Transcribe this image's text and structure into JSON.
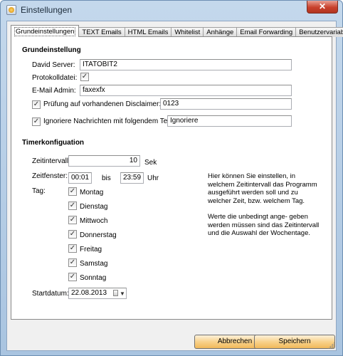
{
  "window": {
    "title": "Einstellungen",
    "close_label": "✕"
  },
  "tabs": [
    {
      "label": "Grundeinstellungen",
      "active": true
    },
    {
      "label": "TEXT Emails"
    },
    {
      "label": "HTML Emails"
    },
    {
      "label": "Whitelist"
    },
    {
      "label": "Anhänge"
    },
    {
      "label": "Email Forwarding"
    },
    {
      "label": "Benutzervariablen"
    }
  ],
  "grund": {
    "title": "Grundeinstellung",
    "david_server_label": "David Server:",
    "david_server_value": "ITATOBIT2",
    "protokoll_label": "Protokolldatei:",
    "protokoll_checked": true,
    "email_admin_label": "E-Mail Admin:",
    "email_admin_value": "faxexfx",
    "disclaimer_label": "Prüfung auf vorhandenen Disclaimer:",
    "disclaimer_checked": true,
    "disclaimer_value": "0123",
    "ignore_label": "Ignoriere Nachrichten mit folgendem Text im Body:",
    "ignore_checked": true,
    "ignore_value": "Ignoriere"
  },
  "timer": {
    "title": "Timerkonfiguation",
    "intervall_label": "Zeitintervall:",
    "intervall_value": "10",
    "intervall_unit": "Sek",
    "fenster_label": "Zeitfenster:",
    "fenster_from": "00:01",
    "fenster_bis": "bis",
    "fenster_to": "23:59",
    "fenster_unit": "Uhr",
    "tag_label": "Tag:",
    "days": [
      {
        "label": "Montag",
        "checked": true
      },
      {
        "label": "Dienstag",
        "checked": true
      },
      {
        "label": "Mittwoch",
        "checked": true
      },
      {
        "label": "Donnerstag",
        "checked": true
      },
      {
        "label": "Freitag",
        "checked": true
      },
      {
        "label": "Samstag",
        "checked": true
      },
      {
        "label": "Sonntag",
        "checked": true
      }
    ],
    "startdatum_label": "Startdatum:",
    "startdatum_value": "22.08.2013"
  },
  "info": {
    "paragraph1": "Hier können Sie einstellen, in welchem Zeitintervall das Programm ausgeführt werden soll und zu welcher Zeit, bzw. welchem Tag.",
    "paragraph2": "Werte die unbedingt ange- geben werden müssen sind das Zeitintervall und die Auswahl der Wochentage."
  },
  "footer": {
    "cancel_label": "Abbrechen",
    "save_label": "Speichern"
  },
  "check_glyph": "✓"
}
